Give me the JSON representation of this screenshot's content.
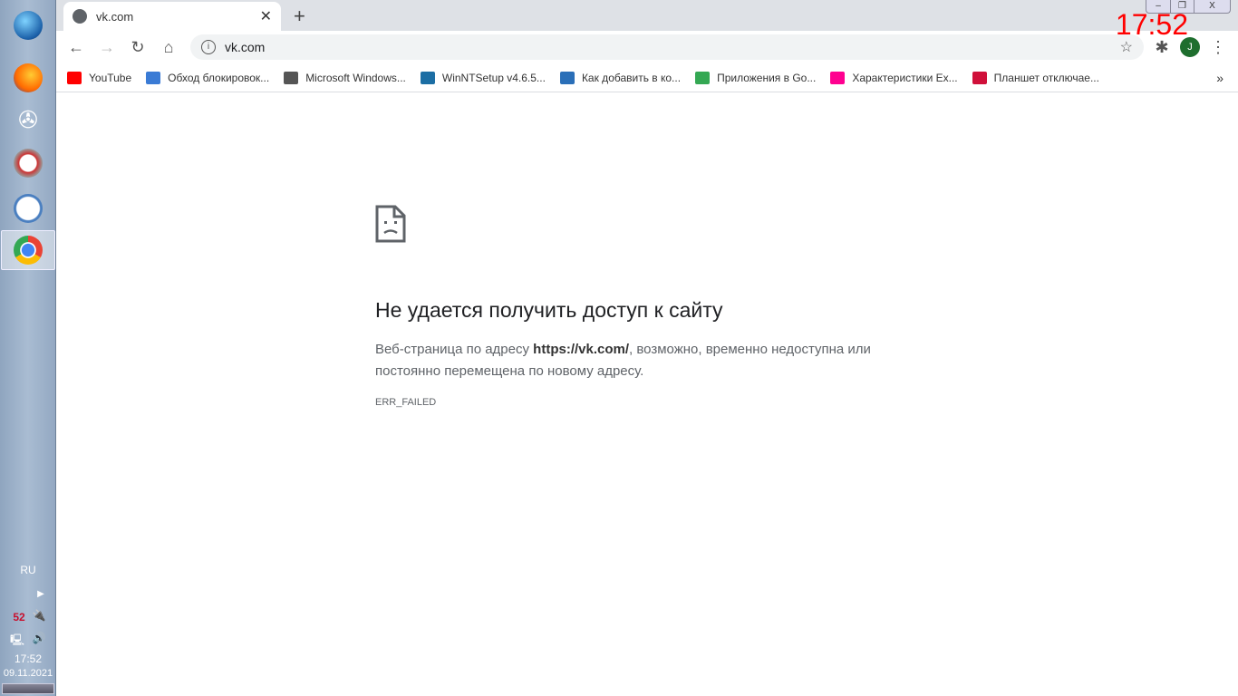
{
  "taskbar": {
    "language": "RU",
    "tray_badge": "52",
    "time": "17:52",
    "date": "09.11.2021",
    "apps": [
      "start-orb",
      "firefox",
      "pinwheel-app",
      "compass-app",
      "clock-app",
      "chrome"
    ]
  },
  "overlay_clock": "17:52",
  "browser": {
    "tab": {
      "title": "vk.com"
    },
    "window_controls": {
      "minimize": "–",
      "restore": "❐",
      "close": "X"
    },
    "address": "vk.com",
    "avatar_letter": "J",
    "bookmarks": [
      {
        "label": "YouTube",
        "color": "#ff0000"
      },
      {
        "label": "Обход блокировок...",
        "color": "#3a7bd5"
      },
      {
        "label": "Microsoft Windows...",
        "color": "#555555"
      },
      {
        "label": "WinNTSetup v4.6.5...",
        "color": "#1c6ea4"
      },
      {
        "label": "Как добавить в ко...",
        "color": "#2a6fb8"
      },
      {
        "label": "Приложения в Go...",
        "color": "#34a853"
      },
      {
        "label": "Характеристики Ex...",
        "color": "#ff0090"
      },
      {
        "label": "Планшет отключае...",
        "color": "#d0103a"
      }
    ],
    "bookmarks_more": "»"
  },
  "error": {
    "title": "Не удается получить доступ к сайту",
    "desc_before": "Веб-страница по адресу ",
    "desc_url": "https://vk.com/",
    "desc_after": ", возможно, временно недоступна или постоянно перемещена по новому адресу.",
    "code": "ERR_FAILED"
  }
}
